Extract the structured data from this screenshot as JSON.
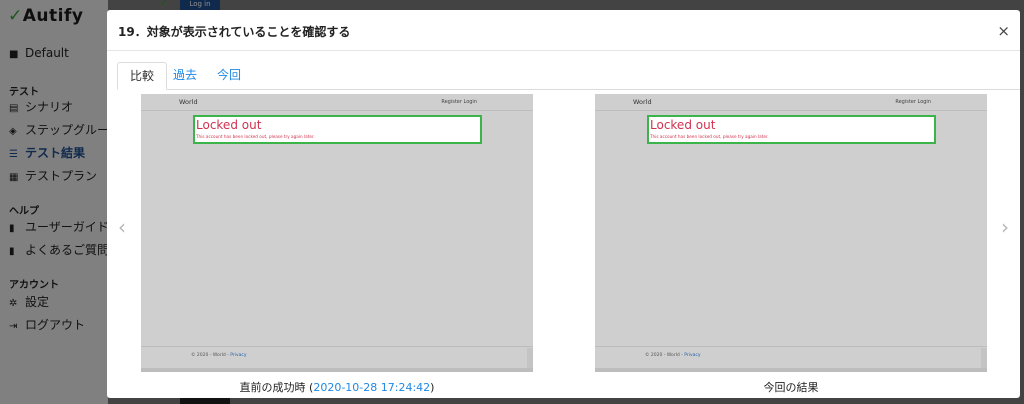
{
  "app": {
    "logo": "Autify",
    "project": "Default",
    "sections": [
      {
        "heading": "テスト",
        "items": [
          "シナリオ",
          "ステップグルー",
          "テスト結果",
          "テストプラン"
        ]
      },
      {
        "heading": "ヘルプ",
        "items": [
          "ユーザーガイド",
          "よくあるご質問"
        ]
      },
      {
        "heading": "アカウント",
        "items": [
          "設定",
          "ログアウト"
        ]
      }
    ],
    "bg_login_button": "Log in"
  },
  "modal": {
    "title": "19．対象が表示されていることを確認する",
    "close_icon": "×",
    "tabs": [
      "比較",
      "過去",
      "今回"
    ],
    "active_tab": "比較",
    "prev_arrow": "‹",
    "next_arrow": "›"
  },
  "panes": [
    {
      "brand": "World",
      "nav": "Register   Login",
      "alert_title": "Locked out",
      "alert_message": "This account has been locked out, please try again later.",
      "footer_text": "© 2020 - World - ",
      "footer_link": "Privacy",
      "caption": "直前の成功時",
      "caption_open": " (",
      "timestamp": "2020-10-28 17:24:42",
      "caption_close": ")"
    },
    {
      "brand": "World",
      "nav": "Register   Login",
      "alert_title": "Locked out",
      "alert_message": "This account has been locked out, please try again later.",
      "footer_text": "© 2020 - World - ",
      "footer_link": "Privacy",
      "caption": "今回の結果"
    }
  ],
  "colors": {
    "accent": "#1e88e5",
    "alert_border": "#3bb54a",
    "alert_text": "#d0324e",
    "active_sidebar": "#1e4d8c"
  }
}
